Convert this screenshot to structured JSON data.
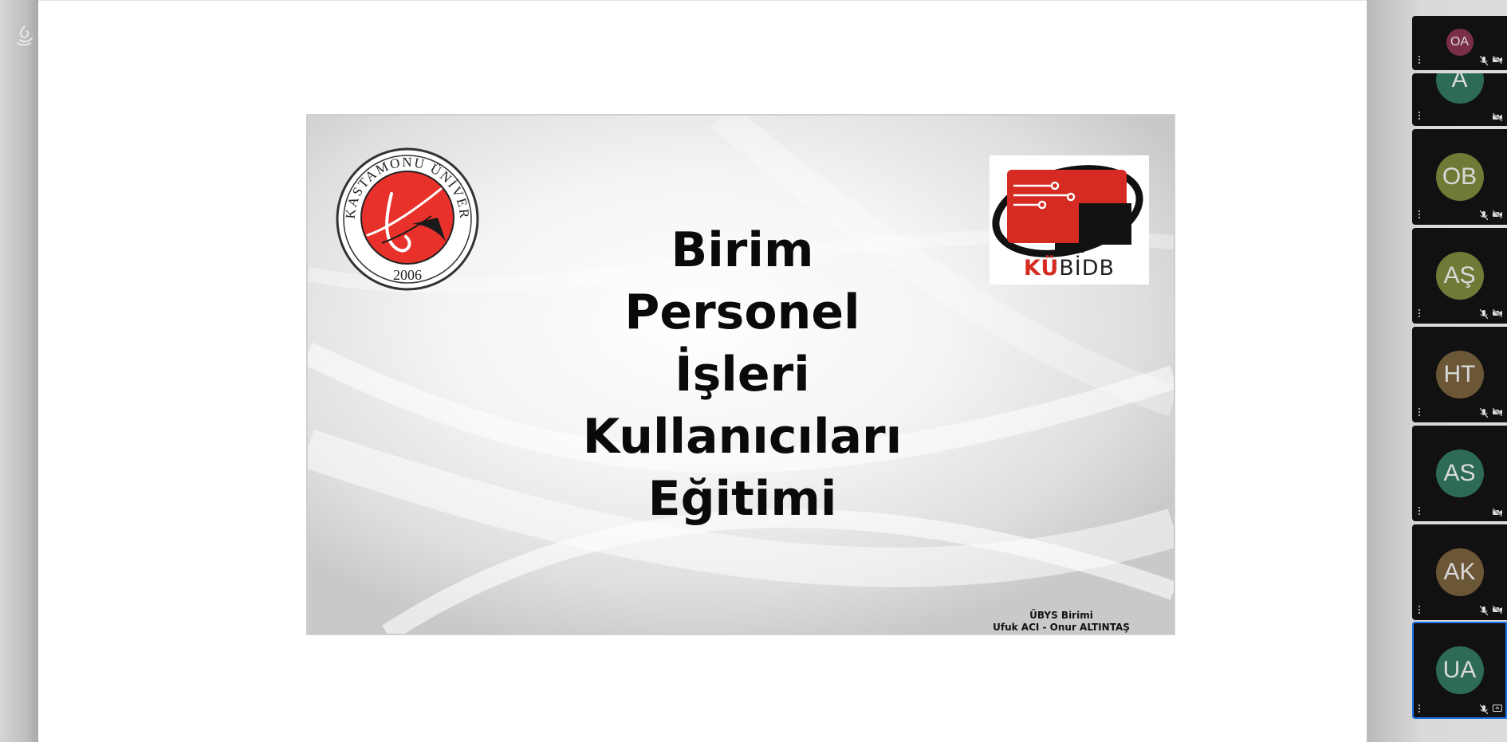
{
  "slide": {
    "title_lines": [
      "Birim",
      "Personel",
      "İşleri",
      "Kullanıcıları",
      "Eğitimi"
    ],
    "seal": {
      "ring_text": "KASTAMONU ÜNİVERSİTESİ",
      "year": "2006",
      "accent_color": "#e8312a"
    },
    "kubidb": {
      "prefix": "KÜ",
      "suffix": "BİDB",
      "accent_color": "#d62b22"
    },
    "footer": {
      "line1": "ÜBYS Birimi",
      "line2": "Ufuk ACI - Onur ALTINTAŞ"
    }
  },
  "participants": [
    {
      "initials": "OA",
      "color": "#7a2e4a",
      "mic": "muted",
      "cam": "off"
    },
    {
      "initials": "A",
      "color": "#2e6b56",
      "mic": "none",
      "cam": "off"
    },
    {
      "initials": "OB",
      "color": "#6f7a36",
      "mic": "muted",
      "cam": "off"
    },
    {
      "initials": "AŞ",
      "color": "#6f7a36",
      "mic": "muted",
      "cam": "off"
    },
    {
      "initials": "HT",
      "color": "#6b5636",
      "mic": "muted",
      "cam": "off"
    },
    {
      "initials": "AS",
      "color": "#2e6b56",
      "mic": "none",
      "cam": "off"
    },
    {
      "initials": "AK",
      "color": "#6b5636",
      "mic": "muted",
      "cam": "off"
    },
    {
      "initials": "UA",
      "color": "#2e6b56",
      "mic": "muted",
      "cam": "presenting",
      "active": true
    }
  ],
  "accent_color": "#1a73e8"
}
